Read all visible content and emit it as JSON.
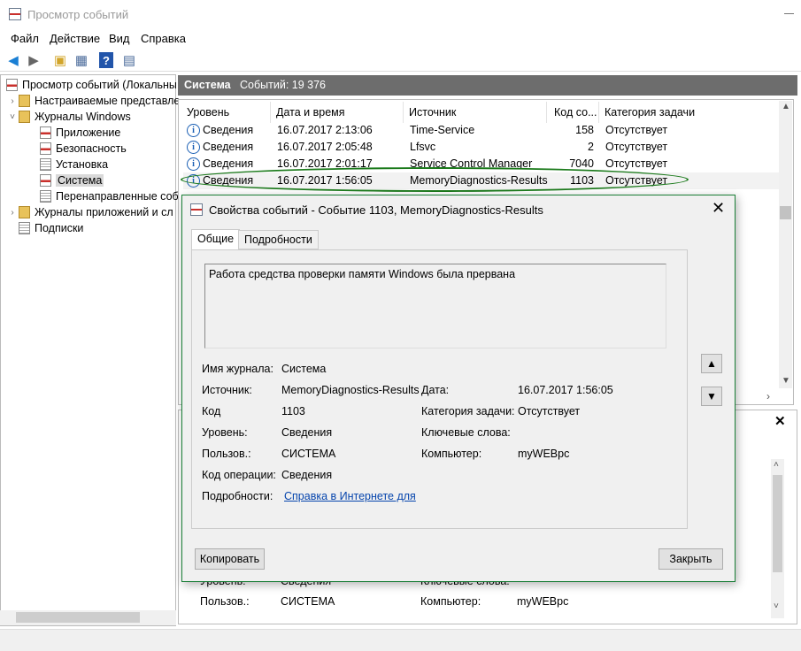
{
  "window": {
    "title": "Просмотр событий"
  },
  "menu": [
    "Файл",
    "Действие",
    "Вид",
    "Справка"
  ],
  "tree": [
    {
      "label": "Просмотр событий (Локальны",
      "level": 0,
      "expander": "",
      "icon": "red"
    },
    {
      "label": "Настраиваемые представле",
      "level": 1,
      "expander": "›",
      "icon": "fold"
    },
    {
      "label": "Журналы Windows",
      "level": 1,
      "expander": "˅",
      "icon": "fold"
    },
    {
      "label": "Приложение",
      "level": 2,
      "expander": "",
      "icon": "red"
    },
    {
      "label": "Безопасность",
      "level": 2,
      "expander": "",
      "icon": "red"
    },
    {
      "label": "Установка",
      "level": 2,
      "expander": "",
      "icon": "log"
    },
    {
      "label": "Система",
      "level": 2,
      "expander": "",
      "icon": "red"
    },
    {
      "label": "Перенаправленные соб",
      "level": 2,
      "expander": "",
      "icon": "log"
    },
    {
      "label": "Журналы приложений и сл",
      "level": 1,
      "expander": "›",
      "icon": "fold"
    },
    {
      "label": "Подписки",
      "level": 1,
      "expander": "",
      "icon": "log"
    }
  ],
  "panel": {
    "name": "Система",
    "count": "Событий: 19 376"
  },
  "columns": [
    "Уровень",
    "Дата и время",
    "Источник",
    "Код со...",
    "Категория задачи"
  ],
  "rows": [
    {
      "level": "Сведения",
      "date": "16.07.2017 2:13:06",
      "source": "Time-Service",
      "code": "158",
      "cat": "Отсутствует"
    },
    {
      "level": "Сведения",
      "date": "16.07.2017 2:05:48",
      "source": "Lfsvc",
      "code": "2",
      "cat": "Отсутствует"
    },
    {
      "level": "Сведения",
      "date": "16.07.2017 2:01:17",
      "source": "Service Control Manager",
      "code": "7040",
      "cat": "Отсутствует"
    },
    {
      "level": "Сведения",
      "date": "16.07.2017 1:56:05",
      "source": "MemoryDiagnostics-Results",
      "code": "1103",
      "cat": "Отсутствует"
    }
  ],
  "bottom": {
    "r1_label": "Уровень:",
    "r1_value": "Сведения",
    "r1_label2": "Ключевые слова:",
    "r2_label": "Пользов.:",
    "r2_value": "СИСТЕМА",
    "r2_label2": "Компьютер:",
    "r2_value2": "myWEBpc"
  },
  "dialog": {
    "title": "Свойства событий - Событие 1103, MemoryDiagnostics-Results",
    "tabs": [
      "Общие",
      "Подробности"
    ],
    "description": "Работа средства проверки памяти Windows была прервана",
    "log_label": "Имя журнала:",
    "log_value": "Система",
    "source_label": "Источник:",
    "source_value": "MemoryDiagnostics-Results",
    "date_label": "Дата:",
    "date_value": "16.07.2017 1:56:05",
    "code_label": "Код",
    "code_value": "1103",
    "task_label": "Категория задачи:",
    "task_value": "Отсутствует",
    "level_label": "Уровень:",
    "level_value": "Сведения",
    "keywords_label": "Ключевые слова:",
    "user_label": "Пользов.:",
    "user_value": "СИСТЕМА",
    "computer_label": "Компьютер:",
    "computer_value": "myWEBpc",
    "opcode_label": "Код операции:",
    "opcode_value": "Сведения",
    "details_label": "Подробности:",
    "details_link": "Справка в Интернете для",
    "copy_button": "Копировать",
    "close_button": "Закрыть"
  }
}
